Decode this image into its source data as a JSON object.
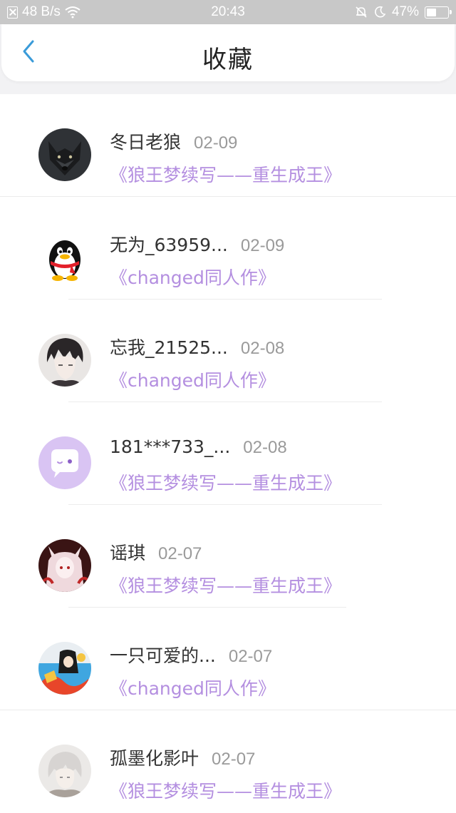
{
  "status_bar": {
    "net_speed": "48 B/s",
    "time": "20:43",
    "battery": "47%",
    "battery_level": 0.47
  },
  "header": {
    "title": "收藏",
    "accent_color": "#3a9bd9"
  },
  "favorites": [
    {
      "name": "冬日老狼",
      "date": "02-09",
      "book": "《狼王梦续写——重生成王》",
      "avatar": "wolf-avatar"
    },
    {
      "name": "无为_63959...",
      "date": "02-09",
      "book": "《changed同人作》",
      "avatar": "qq-penguin-avatar"
    },
    {
      "name": "忘我_21525...",
      "date": "02-08",
      "book": "《changed同人作》",
      "avatar": "anime-boy-avatar"
    },
    {
      "name": "181***733_...",
      "date": "02-08",
      "book": "《狼王梦续写——重生成王》",
      "avatar": "default-chat-avatar"
    },
    {
      "name": "谣琪",
      "date": "02-07",
      "book": "《狼王梦续写——重生成王》",
      "avatar": "fox-girl-avatar"
    },
    {
      "name": "一只可爱的...",
      "date": "02-07",
      "book": "《changed同人作》",
      "avatar": "cartoon-avatar"
    },
    {
      "name": "孤墨化影叶",
      "date": "02-07",
      "book": "《狼王梦续写——重生成王》",
      "avatar": "white-hair-avatar"
    }
  ],
  "colors": {
    "book_title": "#b48fe0",
    "date": "#9a9a9a",
    "name": "#333333"
  }
}
